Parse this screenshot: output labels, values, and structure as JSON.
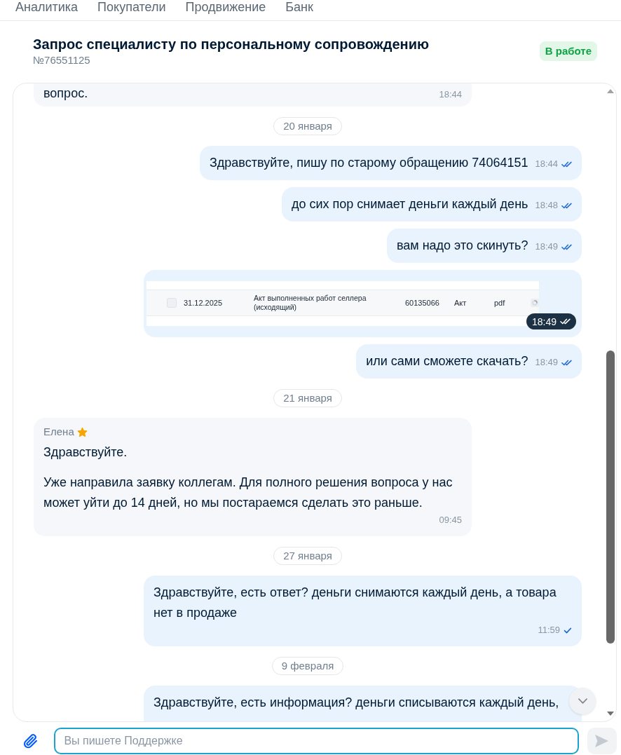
{
  "top_nav": {
    "tabs": [
      {
        "label": "Аналитика"
      },
      {
        "label": "Покупатели"
      },
      {
        "label": "Продвижение"
      },
      {
        "label": "Банк"
      }
    ]
  },
  "request": {
    "title": "Запрос специалисту по персональному сопровождению",
    "number": "№76551125",
    "status": "В работе"
  },
  "chat": {
    "messages": [
      {
        "kind": "text",
        "outgoing": false,
        "paragraphs": [
          "вопрос."
        ],
        "time": "18:44",
        "clipped_top": true,
        "clipped_bottom": false
      },
      {
        "kind": "date",
        "label": "20 января"
      },
      {
        "kind": "text",
        "outgoing": true,
        "paragraphs": [
          "Здравствуйте, пишу по старому обращению 74064151"
        ],
        "time": "18:44",
        "read": true,
        "clipped_top": false,
        "clipped_bottom": false
      },
      {
        "kind": "text",
        "outgoing": true,
        "paragraphs": [
          "до сих пор снимает деньги каждый день"
        ],
        "time": "18:48",
        "read": true,
        "clipped_top": false,
        "clipped_bottom": false
      },
      {
        "kind": "text",
        "outgoing": true,
        "paragraphs": [
          "вам надо это скинуть?"
        ],
        "time": "18:49",
        "read": true,
        "clipped_top": false,
        "clipped_bottom": false
      },
      {
        "kind": "image",
        "outgoing": true,
        "time": "18:49",
        "read": true,
        "clipped_top": false,
        "clipped_bottom": false,
        "screenshot": {
          "checked": false,
          "cells": [
            "31.12.2025",
            "Акт выполненных работ селлера (исходящий)",
            "60135066",
            "Акт",
            "pdf"
          ]
        }
      },
      {
        "kind": "text",
        "outgoing": true,
        "paragraphs": [
          "или сами сможете скачать?"
        ],
        "time": "18:49",
        "read": true,
        "clipped_top": false,
        "clipped_bottom": false
      },
      {
        "kind": "date",
        "label": "21 января"
      },
      {
        "kind": "text",
        "outgoing": false,
        "author": {
          "name": "Елена",
          "starred": true
        },
        "paragraphs": [
          "Здравствуйте.",
          "Уже направила заявку коллегам. Для полного решения вопроса у нас может уйти до 14 дней, но мы постараемся сделать это раньше."
        ],
        "time": "09:45",
        "clipped_top": false,
        "clipped_bottom": false
      },
      {
        "kind": "date",
        "label": "27 января"
      },
      {
        "kind": "text",
        "outgoing": true,
        "paragraphs": [
          "Здравствуйте, есть ответ? деньги снимаются каждый день, а товара нет в продаже"
        ],
        "time": "11:59",
        "read": false,
        "clipped_top": false,
        "clipped_bottom": false
      },
      {
        "kind": "date",
        "label": "9 февраля"
      },
      {
        "kind": "text",
        "outgoing": true,
        "paragraphs": [
          "Здравствуйте, есть информация? деньги списываются каждый день,"
        ],
        "clipped_top": false,
        "clipped_bottom": true
      }
    ]
  },
  "composer": {
    "placeholder": "Вы пишете Поддержке"
  }
}
